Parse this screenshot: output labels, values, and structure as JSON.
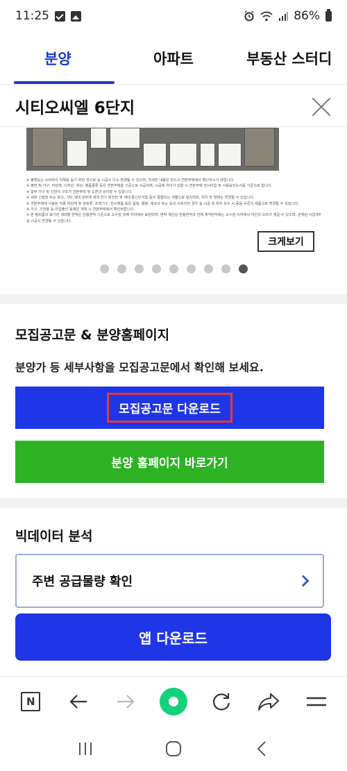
{
  "status_bar": {
    "time": "11:25",
    "battery": "86%"
  },
  "tabs": [
    {
      "label": "분양",
      "active": true
    },
    {
      "label": "아파트",
      "active": false
    },
    {
      "label": "부동산 스터디",
      "active": false
    }
  ],
  "header": {
    "title": "시티오씨엘 6단지"
  },
  "plan": {
    "notes": [
      "※ 평면도는 소비자의 이해를 돕기 위한 것으로 실 시공시 다소 변경될 수 있으며, 자세한 내용은 반드시 견본주택에서 확인하시기 바랍니다.",
      "※ 평면 및 가구, 마감재, 디자인, 색상, 제품종류 등은 견본주택을 기준으로 시공되며, 시공에 차이가 있을 시 견본주택 전시타입 및 사용승인도서를 기준으로 합니다.",
      "※ 일부 가구 및 선반의 구조가 견본주택 및 도면과 상이할 수 있습니다.",
      "※ 세대 신발장 또는 창고, 기타 세대 내부에 세대 전기 분전반 및 세대 통신단자함 등이 통합되는 개별으로 설치되며, 위치 및 형태는 변경될 수 있습니다.",
      "※ 견본주택에 사용된 각종 마감재 및 생호류, 조명기구, 전시제품 등은 품질, 물량, 제조사 또는 등의 수축이한 경우 실 시공 및 위치 보수 시 동등 수준의 제품으로 변경될 수 있습니다.",
      "※ 가구, 기전용 등 유입출선 등제은 계획 시 견본주택에서 확인바랍니다.",
      "※ 본 평회톰의 표기된 세대별 면적은 전용면적 기준으로 소수점 넷째 자리에서 표현되며, 면적 계산상 전용면적과 전체 계약면적에는 소수점 이하에서 약간의 오차가 생길 수 있으며, 관계된 사업계획승인 변경 등으로",
      "  실 시공시 변경될 수 있습니다."
    ],
    "zoom_label": "크게보기",
    "slide_count": 9,
    "active_slide": 8
  },
  "notice": {
    "title": "모집공고문 & 분양홈페이지",
    "description": "분양가 등 세부사항을 모집공고문에서 확인해 보세요.",
    "download_label": "모집공고문 다운로드",
    "homepage_label": "분양 홈페이지 바로가기"
  },
  "bigdata": {
    "title": "빅데이터 분석",
    "supply_label": "주변 공급물량 확인",
    "app_label": "앱 다운로드"
  },
  "toolbar": {
    "n_label": "N"
  },
  "colors": {
    "accent": "#1f36e6",
    "tab_active": "#1a3cc9",
    "green": "#2db224",
    "highlight": "#e53935",
    "browser_green": "#12d27b"
  }
}
